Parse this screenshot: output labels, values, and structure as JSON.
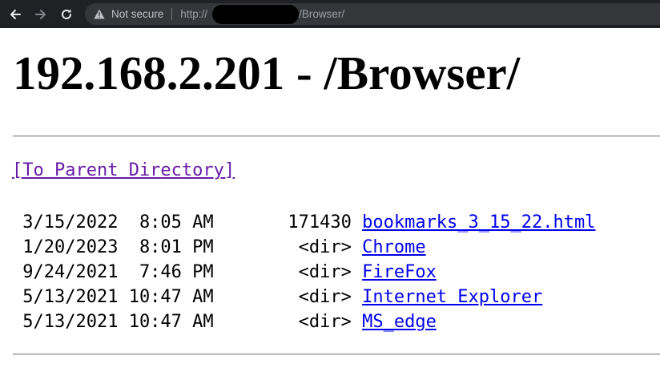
{
  "browser": {
    "security_label": "Not secure",
    "url_prefix": "http://",
    "url_suffix": "/Browser/"
  },
  "page": {
    "title": "192.168.2.201 - /Browser/",
    "parent_link": "[To Parent Directory]"
  },
  "listing": [
    {
      "prefix": " 3/15/2022  8:05 AM       171430 ",
      "name": "bookmarks_3_15_22.html"
    },
    {
      "prefix": " 1/20/2023  8:01 PM        <dir> ",
      "name": "Chrome"
    },
    {
      "prefix": " 9/24/2021  7:46 PM        <dir> ",
      "name": "FireFox"
    },
    {
      "prefix": " 5/13/2021 10:47 AM        <dir> ",
      "name": "Internet Explorer"
    },
    {
      "prefix": " 5/13/2021 10:47 AM        <dir> ",
      "name": "MS_edge"
    }
  ],
  "colors": {
    "toolbar_bg": "#202124",
    "omnibox_bg": "#35363a",
    "link": "#0000ee",
    "visited_link": "#681da8"
  },
  "icons": [
    "back-arrow-icon",
    "forward-arrow-icon",
    "reload-icon",
    "warning-icon"
  ]
}
